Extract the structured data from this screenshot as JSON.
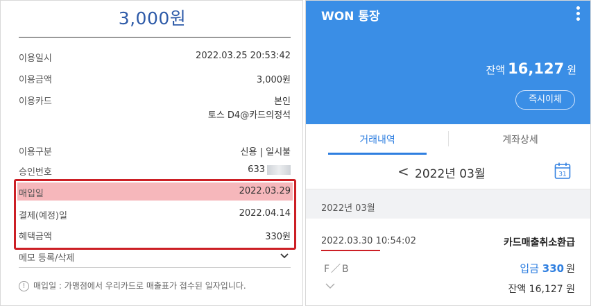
{
  "left": {
    "amount": "3,000원",
    "rows": [
      {
        "label": "이용일시",
        "value": "2022.03.25 20:53:42"
      },
      {
        "label": "이용금액",
        "value": "3,000원"
      },
      {
        "label": "이용카드",
        "value": "본인",
        "value2": "토스 D4@카드의정석"
      },
      {
        "label": "이용구분",
        "value": "신용 | 일시불"
      },
      {
        "label": "승인번호",
        "value": "633"
      },
      {
        "label": "매입일",
        "value": "2022.03.29"
      },
      {
        "label": "결제(예정)일",
        "value": "2022.04.14"
      },
      {
        "label": "혜택금액",
        "value": "330원"
      }
    ],
    "memo_label": "메모 등록/삭제",
    "note": "매입일 : 가맹점에서 우리카드로 매출표가 접수된 일자입니다.",
    "info_glyph": "!"
  },
  "right": {
    "app_title": "WON 통장",
    "balance_prefix": "잔액",
    "balance_value": "16,127",
    "balance_unit": "원",
    "transfer_button": "즉시이체",
    "tabs": [
      "거래내역",
      "계좌상세"
    ],
    "month_label": "2022년 03월",
    "prev_glyph": "<",
    "calendar_day": "31",
    "group_label": "2022년 03월",
    "transaction": {
      "date": "2022.03.30",
      "time": "10:54:02",
      "title": "카드매출취소환급",
      "fb": "F／B",
      "amount_prefix": "입금",
      "amount_value": "330",
      "amount_unit": "원",
      "balance": "잔액 16,127 원"
    }
  },
  "colors": {
    "brand_blue": "#3a8ee6",
    "accent_blue": "#2f7fe0",
    "highlight_red": "#cc1f25",
    "highlight_fill": "#f6b7bb",
    "amount_navy": "#2d5aa8"
  }
}
